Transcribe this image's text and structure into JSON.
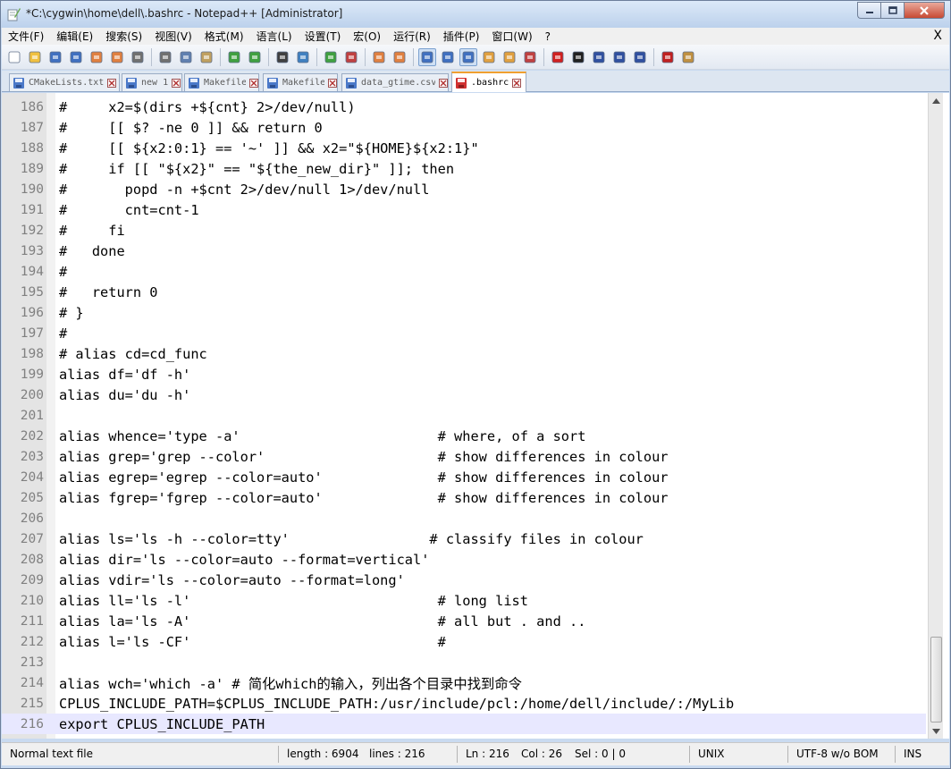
{
  "window": {
    "title": "*C:\\cygwin\\home\\dell\\.bashrc - Notepad++ [Administrator]",
    "app_icon": "notepadpp-icon",
    "buttons": {
      "minimize": "minimize-icon",
      "maximize": "maximize-icon",
      "close": "close-icon"
    }
  },
  "menu": {
    "items": [
      "文件(F)",
      "编辑(E)",
      "搜索(S)",
      "视图(V)",
      "格式(M)",
      "语言(L)",
      "设置(T)",
      "宏(O)",
      "运行(R)",
      "插件(P)",
      "窗口(W)",
      "?"
    ],
    "close_glyph": "X"
  },
  "toolbar": {
    "buttons": [
      {
        "name": "new-file-icon",
        "color": "#ffffff"
      },
      {
        "name": "open-file-icon",
        "color": "#f0c040"
      },
      {
        "name": "save-icon",
        "color": "#4070c0"
      },
      {
        "name": "save-all-icon",
        "color": "#4070c0"
      },
      {
        "name": "close-file-icon",
        "color": "#e08040"
      },
      {
        "name": "close-all-icon",
        "color": "#e08040"
      },
      {
        "name": "print-icon",
        "color": "#707070"
      },
      {
        "name": "cut-icon",
        "color": "#707070"
      },
      {
        "name": "copy-icon",
        "color": "#6080b0"
      },
      {
        "name": "paste-icon",
        "color": "#c0a060"
      },
      {
        "name": "undo-icon",
        "color": "#40a040"
      },
      {
        "name": "redo-icon",
        "color": "#40a040"
      },
      {
        "name": "find-icon",
        "color": "#404040"
      },
      {
        "name": "replace-icon",
        "color": "#4080c0"
      },
      {
        "name": "zoom-in-icon",
        "color": "#40a040"
      },
      {
        "name": "zoom-out-icon",
        "color": "#c04040"
      },
      {
        "name": "sync-vertical-icon",
        "color": "#e08040"
      },
      {
        "name": "sync-horizontal-icon",
        "color": "#e08040"
      },
      {
        "name": "word-wrap-icon",
        "color": "#4070c0"
      },
      {
        "name": "show-all-chars-icon",
        "color": "#4070c0"
      },
      {
        "name": "indent-guide-icon",
        "color": "#4070c0"
      },
      {
        "name": "doc-map-icon",
        "color": "#e0a040"
      },
      {
        "name": "function-list-icon",
        "color": "#e0a040"
      },
      {
        "name": "folder-workspace-icon",
        "color": "#c04040"
      },
      {
        "name": "record-macro-icon",
        "color": "#d02020"
      },
      {
        "name": "stop-macro-icon",
        "color": "#202020"
      },
      {
        "name": "play-macro-icon",
        "color": "#3050a0"
      },
      {
        "name": "play-multiple-macro-icon",
        "color": "#3050a0"
      },
      {
        "name": "save-macro-icon",
        "color": "#3050a0"
      },
      {
        "name": "spell-check-icon",
        "color": "#c02020"
      },
      {
        "name": "plugin-icon",
        "color": "#c09040"
      }
    ]
  },
  "tabs": [
    {
      "label": "CMakeLists.txt",
      "active": false
    },
    {
      "label": "new 1",
      "active": false
    },
    {
      "label": "Makefile",
      "active": false
    },
    {
      "label": "Makefile",
      "active": false
    },
    {
      "label": "data_gtime.csv",
      "active": false
    },
    {
      "label": ".bashrc",
      "active": true
    }
  ],
  "editor": {
    "current_line_color": "#e8e8ff",
    "lines": [
      {
        "n": "186",
        "text": "#     x2=$(dirs +${cnt} 2>/dev/null)"
      },
      {
        "n": "187",
        "text": "#     [[ $? -ne 0 ]] && return 0"
      },
      {
        "n": "188",
        "text": "#     [[ ${x2:0:1} == '~' ]] && x2=\"${HOME}${x2:1}\""
      },
      {
        "n": "189",
        "text": "#     if [[ \"${x2}\" == \"${the_new_dir}\" ]]; then"
      },
      {
        "n": "190",
        "text": "#       popd -n +$cnt 2>/dev/null 1>/dev/null"
      },
      {
        "n": "191",
        "text": "#       cnt=cnt-1"
      },
      {
        "n": "192",
        "text": "#     fi"
      },
      {
        "n": "193",
        "text": "#   done"
      },
      {
        "n": "194",
        "text": "#"
      },
      {
        "n": "195",
        "text": "#   return 0"
      },
      {
        "n": "196",
        "text": "# }"
      },
      {
        "n": "197",
        "text": "#"
      },
      {
        "n": "198",
        "text": "# alias cd=cd_func"
      },
      {
        "n": "199",
        "text": "alias df='df -h'"
      },
      {
        "n": "200",
        "text": "alias du='du -h'"
      },
      {
        "n": "201",
        "text": ""
      },
      {
        "n": "202",
        "text": "alias whence='type -a'                        # where, of a sort"
      },
      {
        "n": "203",
        "text": "alias grep='grep --color'                     # show differences in colour"
      },
      {
        "n": "204",
        "text": "alias egrep='egrep --color=auto'              # show differences in colour"
      },
      {
        "n": "205",
        "text": "alias fgrep='fgrep --color=auto'              # show differences in colour"
      },
      {
        "n": "206",
        "text": ""
      },
      {
        "n": "207",
        "text": "alias ls='ls -h --color=tty'                 # classify files in colour"
      },
      {
        "n": "208",
        "text": "alias dir='ls --color=auto --format=vertical'"
      },
      {
        "n": "209",
        "text": "alias vdir='ls --color=auto --format=long'"
      },
      {
        "n": "210",
        "text": "alias ll='ls -l'                              # long list"
      },
      {
        "n": "211",
        "text": "alias la='ls -A'                              # all but . and .."
      },
      {
        "n": "212",
        "text": "alias l='ls -CF'                              #"
      },
      {
        "n": "213",
        "text": ""
      },
      {
        "n": "214",
        "text": "alias wch='which -a' # 简化which的输入，列出各个目录中找到命令"
      },
      {
        "n": "215",
        "text": "CPLUS_INCLUDE_PATH=$CPLUS_INCLUDE_PATH:/usr/include/pcl:/home/dell/include/:/MyLib"
      },
      {
        "n": "216",
        "text": "export CPLUS_INCLUDE_PATH"
      }
    ]
  },
  "status": {
    "file_type": "Normal text file",
    "length": "length : 6904",
    "lines": "lines : 216",
    "ln": "Ln : 216",
    "col": "Col : 26",
    "sel": "Sel : 0 | 0",
    "eol": "UNIX",
    "encoding": "UTF-8 w/o BOM",
    "mode": "INS"
  }
}
